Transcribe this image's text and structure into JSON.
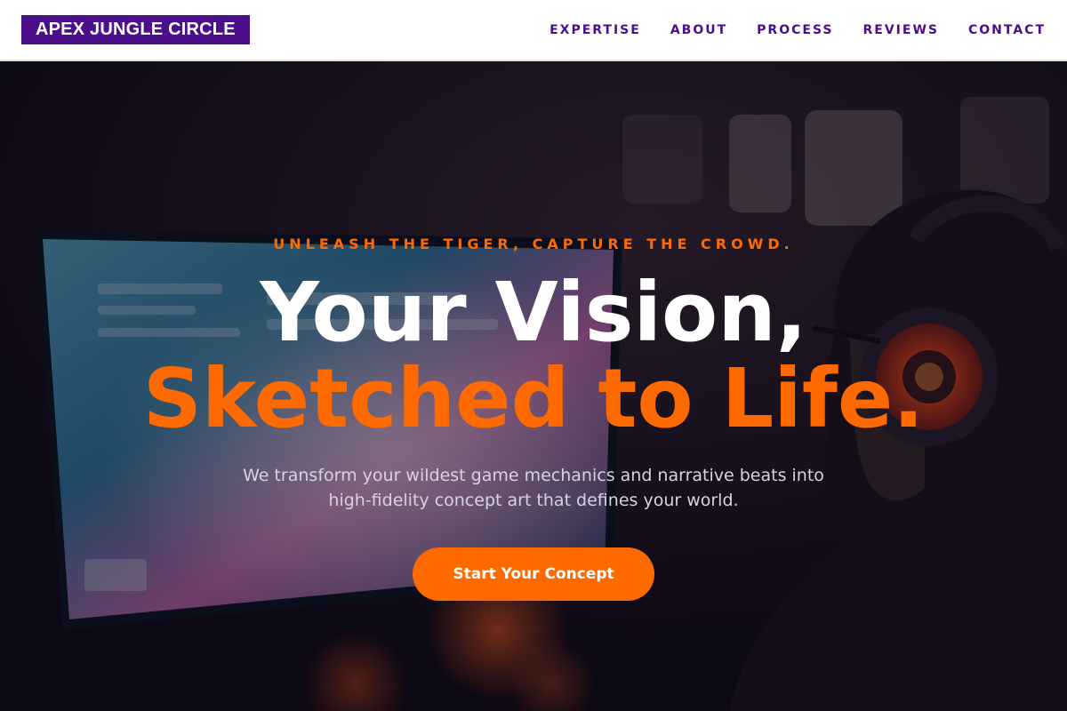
{
  "brand": {
    "logo_text": "APEX JUNGLE CIRCLE"
  },
  "nav": {
    "items": [
      {
        "label": "EXPERTISE"
      },
      {
        "label": "ABOUT"
      },
      {
        "label": "PROCESS"
      },
      {
        "label": "REVIEWS"
      },
      {
        "label": "CONTACT"
      }
    ]
  },
  "hero": {
    "tagline": "UNLEASH THE TIGER, CAPTURE THE CROWD.",
    "title_line1": "Your Vision,",
    "title_line2": "Sketched to Life.",
    "subtitle": "We transform your wildest game mechanics and narrative beats into high-fidelity concept art that defines your world.",
    "cta_label": "Start Your Concept",
    "background_image": "gamer-with-headphones-at-monitor-photo"
  },
  "colors": {
    "brand_purple": "#4b0f8c",
    "accent_orange": "#ff6a00",
    "nav_bg": "#ffffff",
    "hero_text": "#ffffff"
  }
}
